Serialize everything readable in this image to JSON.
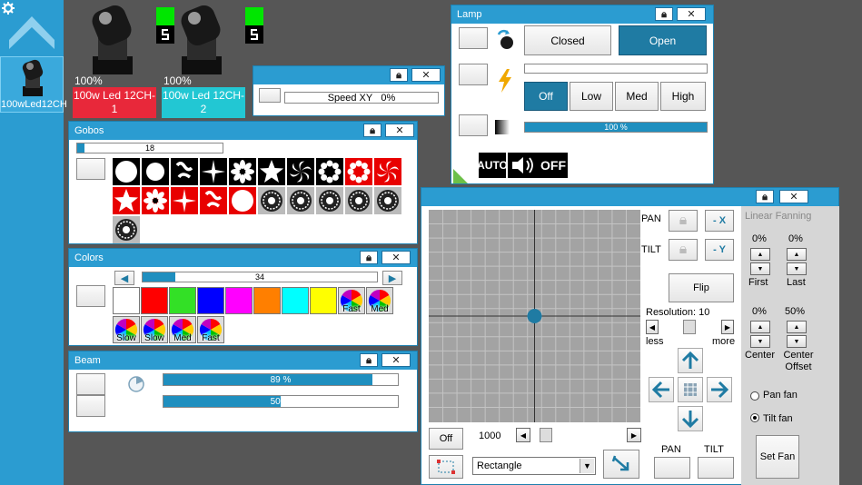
{
  "sidebar": {
    "fixture_label": "100wLed12CH",
    "icons": [
      "gear-icon",
      "chevron-up-icon"
    ]
  },
  "fixtures": [
    {
      "percent": "100%",
      "name": "100w Led 12CH-1",
      "color": "#e8283a"
    },
    {
      "percent": "100%",
      "name": "100w Led 12CH-2",
      "color": "#22c7d3"
    }
  ],
  "speed_panel": {
    "label": "Speed XY",
    "percent": "0%",
    "value": 0
  },
  "gobos_panel": {
    "title": "Gobos",
    "value": "18",
    "fill": 0.05
  },
  "colors_panel": {
    "title": "Colors",
    "value": "34",
    "fill": 0.14,
    "swatches": [
      "#ffffff",
      "#ff0000",
      "#33e026",
      "#0000ff",
      "#ff00ff",
      "#ff7f00",
      "#00ffff",
      "#ffff00"
    ],
    "wheel_labels": [
      "Fast",
      "Med",
      "Slow",
      "Slow",
      "Med",
      "Fast"
    ]
  },
  "beam_panel": {
    "title": "Beam",
    "bar1": "89 %",
    "bar1_fill": 0.89,
    "bar2": "50 %",
    "bar2_fill": 0.5
  },
  "lamp_panel": {
    "title": "Lamp",
    "closed_label": "Closed",
    "open_label": "Open",
    "off_label": "Off",
    "low_label": "Low",
    "med_label": "Med",
    "high_label": "High",
    "dimmer": "100 %",
    "dimmer_fill": 1.0,
    "auto_label": "AUTO",
    "off2_label": "OFF"
  },
  "xy_panel": {
    "pan_label": "PAN",
    "tilt_label": "TILT",
    "pan_btn": "- X",
    "tilt_btn": "- Y",
    "flip_label": "Flip",
    "resolution_label": "Resolution: 10",
    "less_label": "less",
    "more_label": "more",
    "off_label": "Off",
    "speed_value": "1000",
    "shape_value": "Rectangle",
    "pan_bottom": "PAN",
    "tilt_bottom": "TILT",
    "fanning_title": "Linear Fanning",
    "first_pct": "0%",
    "last_pct": "0%",
    "first_label": "First",
    "last_label": "Last",
    "center_pct": "0%",
    "offset_pct": "50%",
    "center_label": "Center",
    "center_offset_label": "Center Offset",
    "pan_fan_label": "Pan fan",
    "tilt_fan_label": "Tilt fan",
    "set_fan_label": "Set Fan"
  }
}
